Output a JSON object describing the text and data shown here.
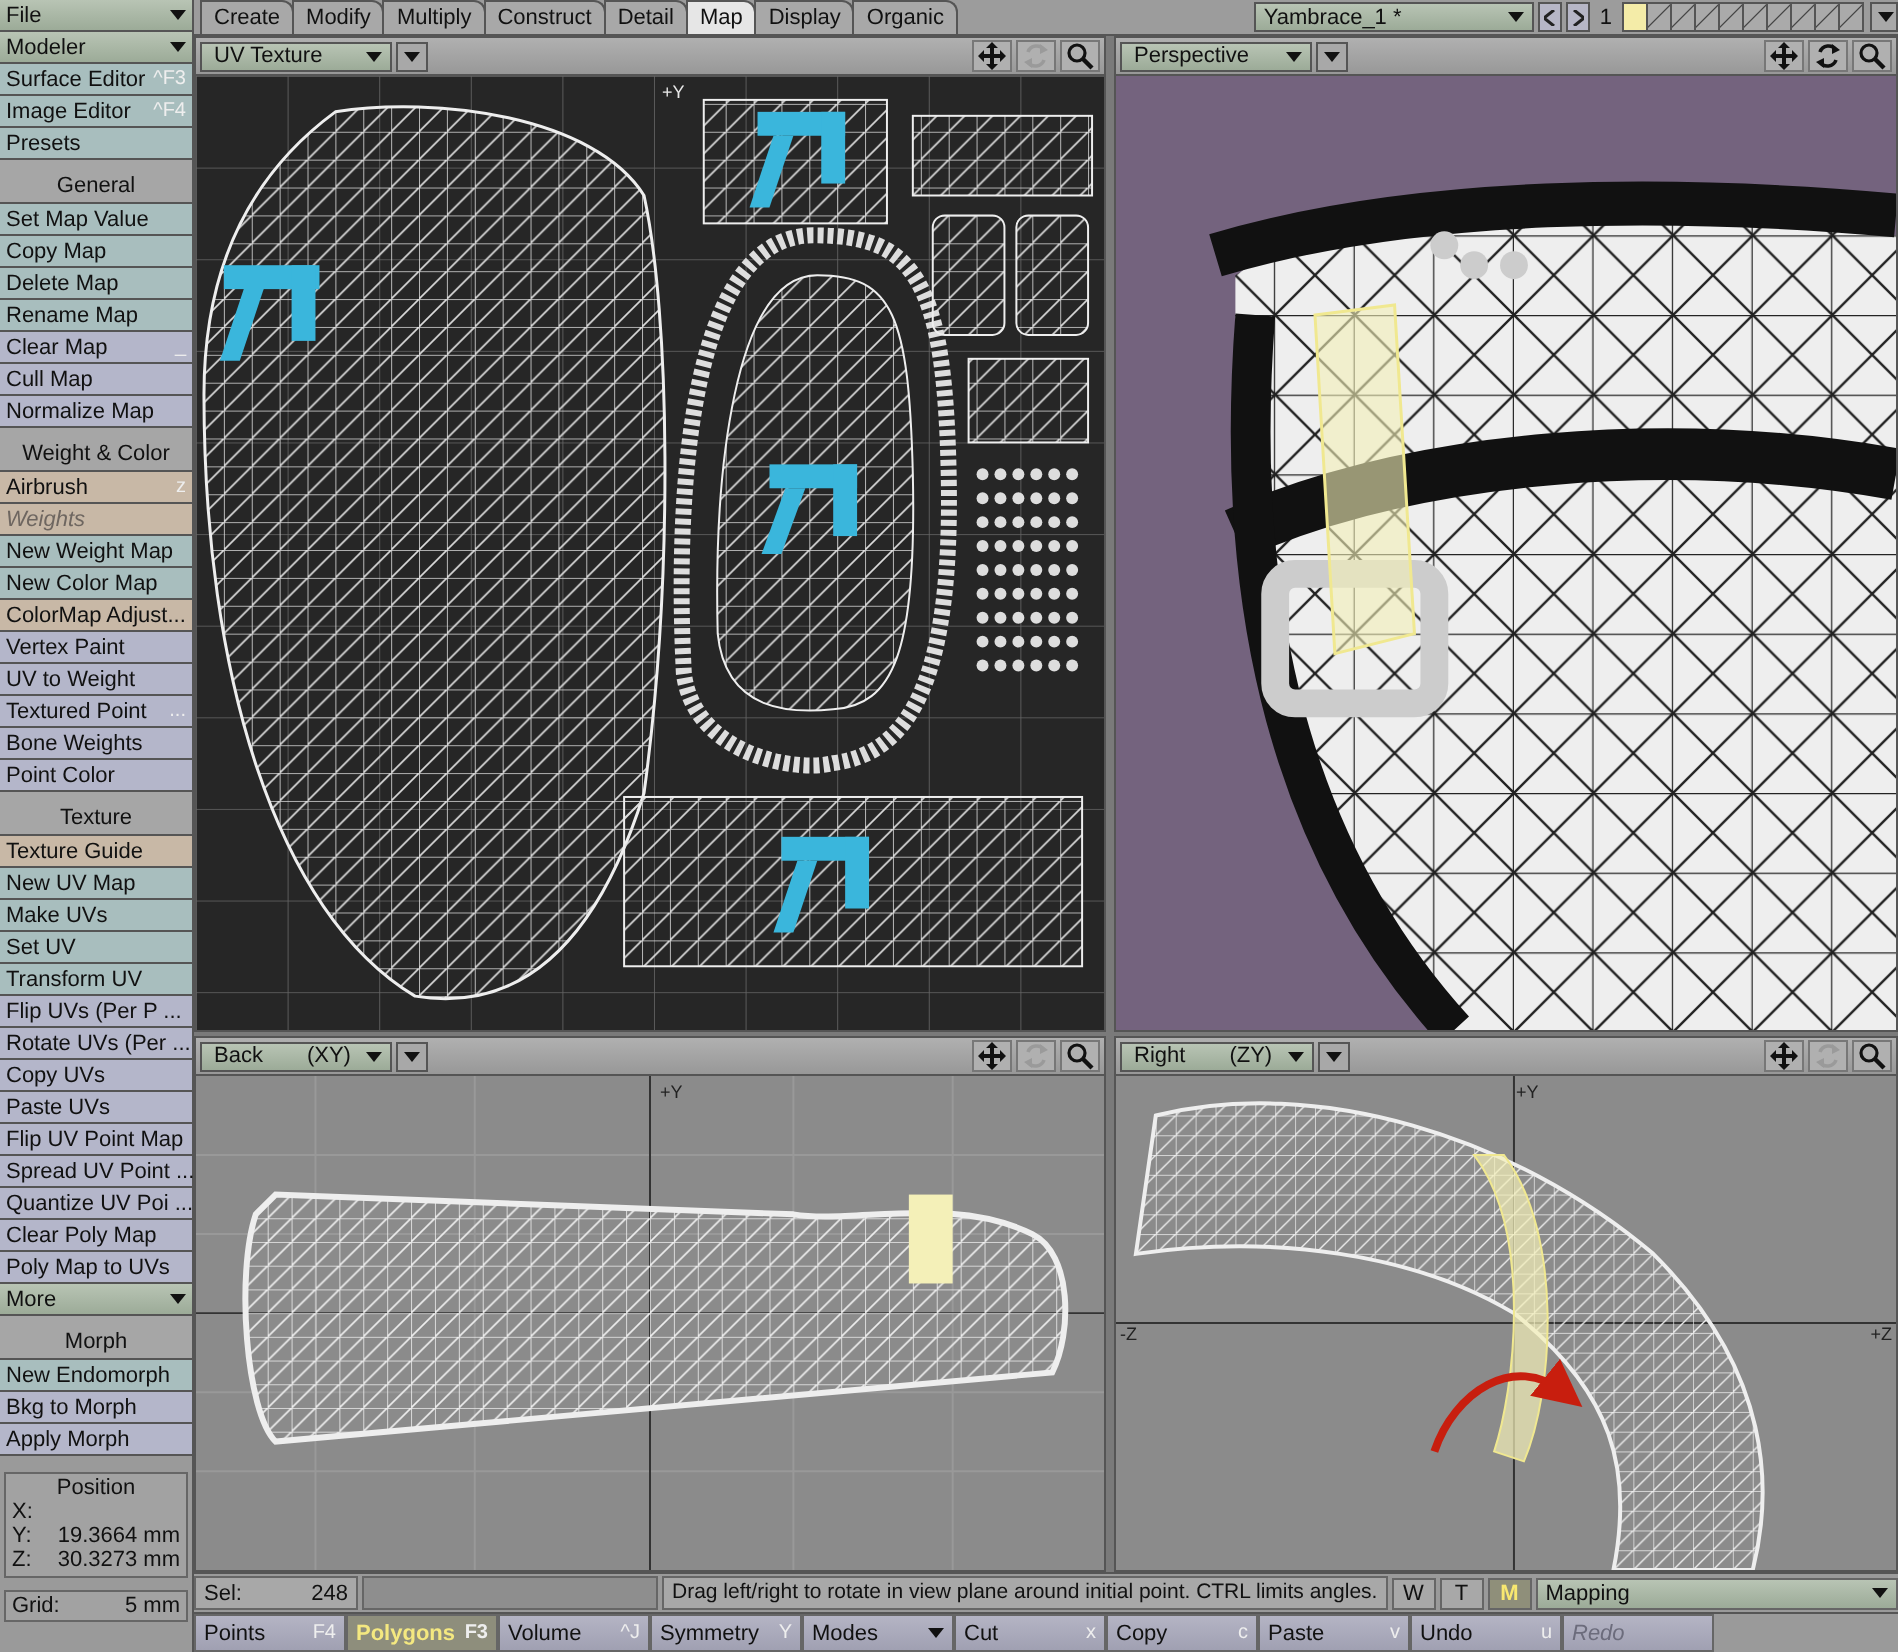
{
  "tabs": [
    {
      "label": "Create",
      "selected": false
    },
    {
      "label": "Modify",
      "selected": false
    },
    {
      "label": "Multiply",
      "selected": false
    },
    {
      "label": "Construct",
      "selected": false
    },
    {
      "label": "Detail",
      "selected": false
    },
    {
      "label": "Map",
      "selected": true
    },
    {
      "label": "Display",
      "selected": false
    },
    {
      "label": "Organic",
      "selected": false
    }
  ],
  "object_selector": {
    "value": "Yambrace_1 *"
  },
  "layer_bank": {
    "number": "1",
    "layers": [
      {
        "selected": true
      },
      {
        "selected": false
      },
      {
        "selected": false
      },
      {
        "selected": false
      },
      {
        "selected": false
      },
      {
        "selected": false
      },
      {
        "selected": false
      },
      {
        "selected": false
      },
      {
        "selected": false
      },
      {
        "selected": false
      }
    ]
  },
  "sidebar": {
    "items": [
      {
        "kind": "dropdown",
        "label": "File"
      },
      {
        "kind": "dropdown",
        "label": "Modeler"
      },
      {
        "kind": "button",
        "label": "Surface Editor",
        "shortcut": "^F3",
        "color": "#a8bebe",
        "disabled": false
      },
      {
        "kind": "button",
        "label": "Image Editor",
        "shortcut": "^F4",
        "color": "#a8bebe",
        "disabled": false
      },
      {
        "kind": "button",
        "label": "Presets",
        "color": "#a8bebe",
        "disabled": false
      },
      {
        "kind": "header",
        "label": "General"
      },
      {
        "kind": "button",
        "label": "Set Map Value",
        "color": "#a8bebe",
        "disabled": false
      },
      {
        "kind": "button",
        "label": "Copy Map",
        "color": "#a8bebe",
        "disabled": false
      },
      {
        "kind": "button",
        "label": "Delete Map",
        "color": "#a8bebe",
        "disabled": false
      },
      {
        "kind": "button",
        "label": "Rename Map",
        "color": "#a8bebe",
        "disabled": false
      },
      {
        "kind": "button",
        "label": "Clear Map",
        "shortcut": "_",
        "color": "#b4b6ca",
        "disabled": false
      },
      {
        "kind": "button",
        "label": "Cull Map",
        "color": "#b4b6ca",
        "disabled": false
      },
      {
        "kind": "button",
        "label": "Normalize Map",
        "color": "#b4b6ca",
        "disabled": false
      },
      {
        "kind": "header",
        "label": "Weight & Color"
      },
      {
        "kind": "button",
        "label": "Airbrush",
        "shortcut": "z",
        "color": "#c8b8a6",
        "disabled": false
      },
      {
        "kind": "button",
        "label": "Weights",
        "color": "#c8b8a6",
        "disabled": true
      },
      {
        "kind": "button",
        "label": "New Weight Map",
        "color": "#a8bebe",
        "disabled": false
      },
      {
        "kind": "button",
        "label": "New Color Map",
        "color": "#a8bebe",
        "disabled": false
      },
      {
        "kind": "button",
        "label": "ColorMap Adjust...",
        "color": "#c8b8a6",
        "disabled": false
      },
      {
        "kind": "button",
        "label": "Vertex Paint",
        "color": "#b4b6ca",
        "disabled": false
      },
      {
        "kind": "button",
        "label": "UV to Weight",
        "color": "#b4b6ca",
        "disabled": false
      },
      {
        "kind": "button",
        "label": "Textured Point",
        "shortcut": "...",
        "color": "#b4b6ca",
        "disabled": false
      },
      {
        "kind": "button",
        "label": "Bone Weights",
        "color": "#b4b6ca",
        "disabled": false
      },
      {
        "kind": "button",
        "label": "Point Color",
        "color": "#b4b6ca",
        "disabled": false
      },
      {
        "kind": "header",
        "label": "Texture"
      },
      {
        "kind": "button",
        "label": "Texture Guide",
        "color": "#c8b8a6",
        "disabled": false
      },
      {
        "kind": "button",
        "label": "New UV Map",
        "color": "#a8bebe",
        "disabled": false
      },
      {
        "kind": "button",
        "label": "Make UVs",
        "color": "#a8bebe",
        "disabled": false
      },
      {
        "kind": "button",
        "label": "Set UV",
        "color": "#a8bebe",
        "disabled": false
      },
      {
        "kind": "button",
        "label": "Transform UV",
        "color": "#a8bebe",
        "disabled": false
      },
      {
        "kind": "button",
        "label": "Flip UVs (Per P ...",
        "color": "#b4b6ca",
        "disabled": false
      },
      {
        "kind": "button",
        "label": "Rotate UVs (Per ...",
        "color": "#b4b6ca",
        "disabled": false
      },
      {
        "kind": "button",
        "label": "Copy UVs",
        "color": "#b4b6ca",
        "disabled": false
      },
      {
        "kind": "button",
        "label": "Paste UVs",
        "color": "#b4b6ca",
        "disabled": false
      },
      {
        "kind": "button",
        "label": "Flip UV Point Map",
        "color": "#b4b6ca",
        "disabled": false
      },
      {
        "kind": "button",
        "label": "Spread UV Point ...",
        "color": "#b4b6ca",
        "disabled": false
      },
      {
        "kind": "button",
        "label": "Quantize UV Poi ...",
        "color": "#b4b6ca",
        "disabled": false
      },
      {
        "kind": "button",
        "label": "Clear Poly Map",
        "color": "#b4b6ca",
        "disabled": false
      },
      {
        "kind": "button",
        "label": "Poly Map to UVs",
        "color": "#b4b6ca",
        "disabled": false
      },
      {
        "kind": "dropdown",
        "label": "More"
      },
      {
        "kind": "header",
        "label": "Morph"
      },
      {
        "kind": "button",
        "label": "New Endomorph",
        "color": "#a8bebe",
        "disabled": false
      },
      {
        "kind": "button",
        "label": "Bkg to Morph",
        "color": "#b4b6ca",
        "disabled": false
      },
      {
        "kind": "button",
        "label": "Apply Morph",
        "color": "#b4b6ca",
        "disabled": false
      }
    ]
  },
  "position": {
    "title": "Position",
    "rows": [
      {
        "axis": "X:"
      },
      {
        "axis": "Y:",
        "value": "19.3664 mm"
      },
      {
        "axis": "Z:",
        "value": "30.3273 mm"
      }
    ]
  },
  "grid": {
    "label": "Grid:",
    "value": "5 mm"
  },
  "viewports": [
    {
      "kind": "uv",
      "view": "UV Texture",
      "tools": [
        {
          "kind": "move",
          "disabled": false
        },
        {
          "kind": "rotate",
          "disabled": true
        },
        {
          "kind": "zoom",
          "disabled": false
        }
      ],
      "axis_labels": [
        {
          "label": "+Y",
          "kind": "top"
        }
      ]
    },
    {
      "kind": "perspective",
      "view": "Perspective",
      "tools": [
        {
          "kind": "move",
          "disabled": false
        },
        {
          "kind": "rotate",
          "disabled": false
        },
        {
          "kind": "zoom",
          "disabled": false
        }
      ]
    },
    {
      "kind": "back",
      "view": "Back",
      "plane": "(XY)",
      "tools": [
        {
          "kind": "move",
          "disabled": false
        },
        {
          "kind": "rotate",
          "disabled": true
        },
        {
          "kind": "zoom",
          "disabled": false
        }
      ],
      "axis_labels": [
        {
          "label": "+Y",
          "kind": "top"
        }
      ]
    },
    {
      "kind": "right",
      "view": "Right",
      "plane": "(ZY)",
      "tools": [
        {
          "kind": "move",
          "disabled": false
        },
        {
          "kind": "rotate",
          "disabled": true
        },
        {
          "kind": "zoom",
          "disabled": false
        }
      ],
      "axis_labels": [
        {
          "label": "+Y",
          "kind": "top"
        },
        {
          "label": "-Z",
          "kind": "left"
        },
        {
          "label": "+Z",
          "kind": "right"
        }
      ]
    }
  ],
  "status_bar": {
    "selection_label": "Sel:",
    "selection_count": "248",
    "message": "Drag left/right to rotate in view plane around initial point. CTRL limits angles.",
    "modes": [
      {
        "label": "W",
        "selected": false
      },
      {
        "label": "T",
        "selected": false
      },
      {
        "label": "M",
        "selected": true
      }
    ],
    "mapping": "Mapping"
  },
  "toolbar": [
    {
      "kind": "button",
      "label": "Points",
      "shortcut": "F4",
      "selected": false,
      "disabled": false
    },
    {
      "kind": "button",
      "label": "Polygons",
      "shortcut": "F3",
      "selected": true,
      "disabled": false
    },
    {
      "kind": "button",
      "label": "Volume",
      "shortcut": "^J",
      "selected": false,
      "disabled": false
    },
    {
      "kind": "button",
      "label": "Symmetry",
      "shortcut": "Y",
      "selected": false,
      "disabled": false
    },
    {
      "kind": "dropdown",
      "label": "Modes",
      "selected": false,
      "disabled": false
    },
    {
      "kind": "button",
      "label": "Cut",
      "shortcut": "x",
      "selected": false,
      "disabled": false
    },
    {
      "kind": "button",
      "label": "Copy",
      "shortcut": "c",
      "selected": false,
      "disabled": false
    },
    {
      "kind": "button",
      "label": "Paste",
      "shortcut": "v",
      "selected": false,
      "disabled": false
    },
    {
      "kind": "button",
      "label": "Undo",
      "shortcut": "u",
      "selected": false,
      "disabled": false
    },
    {
      "kind": "button",
      "label": "Redo",
      "selected": false,
      "disabled": true
    }
  ]
}
